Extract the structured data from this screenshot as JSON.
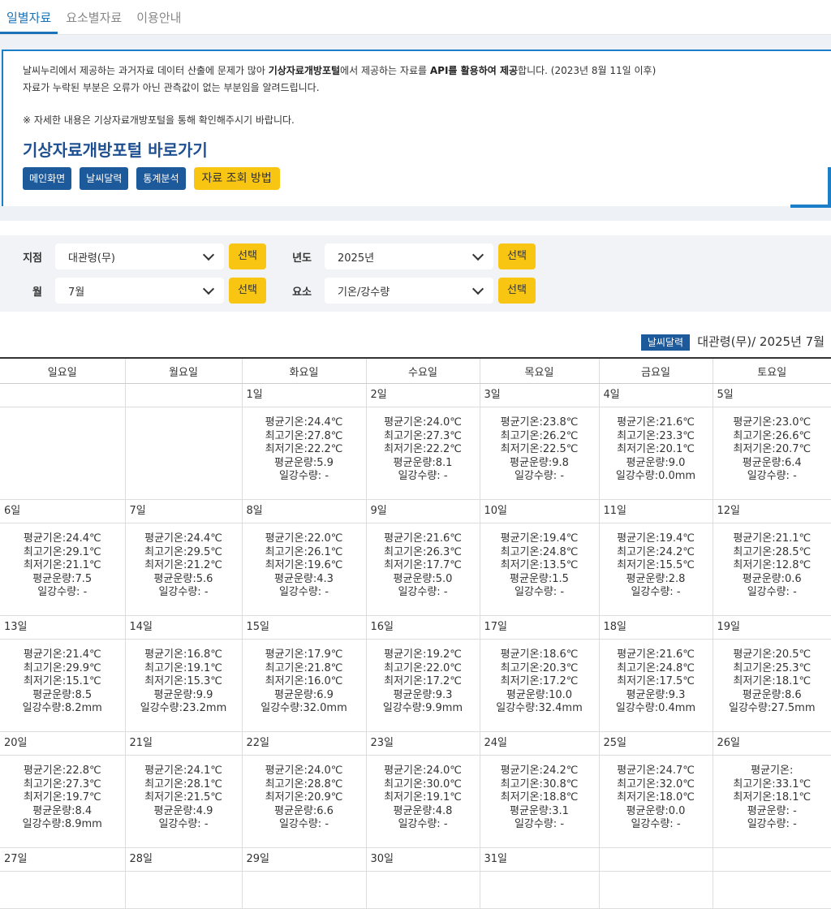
{
  "tabs": [
    "일별자료",
    "요소별자료",
    "이용안내"
  ],
  "notice": {
    "line1_a": "날씨누리에서 제공하는 과거자료 데이터 산출에 문제가 많아 ",
    "line1_b": "기상자료개방포털",
    "line1_c": "에서 제공하는 자료를 ",
    "line1_d": "API를 활용하여 제공",
    "line1_e": "합니다. (2023년 8월 11일 이후)",
    "line2": "자료가 누락된 부분은 오류가 아닌 관측값이 없는 부분임을 알려드립니다.",
    "line3": "※ 자세한 내용은 기상자료개방포털을 통해 확인해주시기 바랍니다.",
    "portal_link": "기상자료개방포털 바로가기",
    "buttons": [
      "메인화면",
      "날씨달력",
      "통계분석"
    ],
    "guide_button": "자료 조회 방법"
  },
  "filters": {
    "station_label": "지점",
    "station_value": "대관령(무)",
    "year_label": "년도",
    "year_value": "2025년",
    "month_label": "월",
    "month_value": "7월",
    "element_label": "요소",
    "element_value": "기온/강수량",
    "select_label": "선택"
  },
  "calendar": {
    "badge": "날씨달력",
    "title": "대관령(무)/ 2025년 7월",
    "weekdays": [
      "일요일",
      "월요일",
      "화요일",
      "수요일",
      "목요일",
      "금요일",
      "토요일"
    ],
    "weeks": [
      [
        {
          "d": "",
          "v": []
        },
        {
          "d": "",
          "v": []
        },
        {
          "d": "1일",
          "v": [
            "평균기온:24.4℃",
            "최고기온:27.8℃",
            "최저기온:22.2℃",
            "평균운량:5.9",
            "일강수량: -"
          ]
        },
        {
          "d": "2일",
          "v": [
            "평균기온:24.0℃",
            "최고기온:27.3℃",
            "최저기온:22.2℃",
            "평균운량:8.1",
            "일강수량: -"
          ]
        },
        {
          "d": "3일",
          "v": [
            "평균기온:23.8℃",
            "최고기온:26.2℃",
            "최저기온:22.5℃",
            "평균운량:9.8",
            "일강수량: -"
          ]
        },
        {
          "d": "4일",
          "v": [
            "평균기온:21.6℃",
            "최고기온:23.3℃",
            "최저기온:20.1℃",
            "평균운량:9.0",
            "일강수량:0.0mm"
          ]
        },
        {
          "d": "5일",
          "v": [
            "평균기온:23.0℃",
            "최고기온:26.6℃",
            "최저기온:20.7℃",
            "평균운량:6.4",
            "일강수량: -"
          ]
        }
      ],
      [
        {
          "d": "6일",
          "v": [
            "평균기온:24.4℃",
            "최고기온:29.1℃",
            "최저기온:21.1℃",
            "평균운량:7.5",
            "일강수량: -"
          ]
        },
        {
          "d": "7일",
          "v": [
            "평균기온:24.4℃",
            "최고기온:29.5℃",
            "최저기온:21.2℃",
            "평균운량:5.6",
            "일강수량: -"
          ]
        },
        {
          "d": "8일",
          "v": [
            "평균기온:22.0℃",
            "최고기온:26.1℃",
            "최저기온:19.6℃",
            "평균운량:4.3",
            "일강수량: -"
          ]
        },
        {
          "d": "9일",
          "v": [
            "평균기온:21.6℃",
            "최고기온:26.3℃",
            "최저기온:17.7℃",
            "평균운량:5.0",
            "일강수량: -"
          ]
        },
        {
          "d": "10일",
          "v": [
            "평균기온:19.4℃",
            "최고기온:24.8℃",
            "최저기온:13.5℃",
            "평균운량:1.5",
            "일강수량: -"
          ]
        },
        {
          "d": "11일",
          "v": [
            "평균기온:19.4℃",
            "최고기온:24.2℃",
            "최저기온:15.5℃",
            "평균운량:2.8",
            "일강수량: -"
          ]
        },
        {
          "d": "12일",
          "v": [
            "평균기온:21.1℃",
            "최고기온:28.5℃",
            "최저기온:12.8℃",
            "평균운량:0.6",
            "일강수량: -"
          ]
        }
      ],
      [
        {
          "d": "13일",
          "v": [
            "평균기온:21.4℃",
            "최고기온:29.9℃",
            "최저기온:15.1℃",
            "평균운량:8.5",
            "일강수량:8.2mm"
          ]
        },
        {
          "d": "14일",
          "v": [
            "평균기온:16.8℃",
            "최고기온:19.1℃",
            "최저기온:15.3℃",
            "평균운량:9.9",
            "일강수량:23.2mm"
          ]
        },
        {
          "d": "15일",
          "v": [
            "평균기온:17.9℃",
            "최고기온:21.8℃",
            "최저기온:16.0℃",
            "평균운량:6.9",
            "일강수량:32.0mm"
          ]
        },
        {
          "d": "16일",
          "v": [
            "평균기온:19.2℃",
            "최고기온:22.0℃",
            "최저기온:17.2℃",
            "평균운량:9.3",
            "일강수량:9.9mm"
          ]
        },
        {
          "d": "17일",
          "v": [
            "평균기온:18.6℃",
            "최고기온:20.3℃",
            "최저기온:17.2℃",
            "평균운량:10.0",
            "일강수량:32.4mm"
          ]
        },
        {
          "d": "18일",
          "v": [
            "평균기온:21.6℃",
            "최고기온:24.8℃",
            "최저기온:17.5℃",
            "평균운량:9.3",
            "일강수량:0.4mm"
          ]
        },
        {
          "d": "19일",
          "v": [
            "평균기온:20.5℃",
            "최고기온:25.3℃",
            "최저기온:18.1℃",
            "평균운량:8.6",
            "일강수량:27.5mm"
          ]
        }
      ],
      [
        {
          "d": "20일",
          "v": [
            "평균기온:22.8℃",
            "최고기온:27.3℃",
            "최저기온:19.7℃",
            "평균운량:8.4",
            "일강수량:8.9mm"
          ]
        },
        {
          "d": "21일",
          "v": [
            "평균기온:24.1℃",
            "최고기온:28.1℃",
            "최저기온:21.5℃",
            "평균운량:4.9",
            "일강수량: -"
          ]
        },
        {
          "d": "22일",
          "v": [
            "평균기온:24.0℃",
            "최고기온:28.8℃",
            "최저기온:20.9℃",
            "평균운량:6.6",
            "일강수량: -"
          ]
        },
        {
          "d": "23일",
          "v": [
            "평균기온:24.0℃",
            "최고기온:30.0℃",
            "최저기온:19.1℃",
            "평균운량:4.8",
            "일강수량: -"
          ]
        },
        {
          "d": "24일",
          "v": [
            "평균기온:24.2℃",
            "최고기온:30.8℃",
            "최저기온:18.8℃",
            "평균운량:3.1",
            "일강수량: -"
          ]
        },
        {
          "d": "25일",
          "v": [
            "평균기온:24.7℃",
            "최고기온:32.0℃",
            "최저기온:18.0℃",
            "평균운량:0.0",
            "일강수량: -"
          ]
        },
        {
          "d": "26일",
          "v": [
            "평균기온:",
            "최고기온:33.1℃",
            "최저기온:18.1℃",
            "평균운량: -",
            "일강수량: -"
          ]
        }
      ],
      [
        {
          "d": "27일",
          "v": []
        },
        {
          "d": "28일",
          "v": []
        },
        {
          "d": "29일",
          "v": []
        },
        {
          "d": "30일",
          "v": []
        },
        {
          "d": "31일",
          "v": []
        },
        {
          "d": "",
          "v": []
        },
        {
          "d": "",
          "v": []
        }
      ]
    ]
  }
}
